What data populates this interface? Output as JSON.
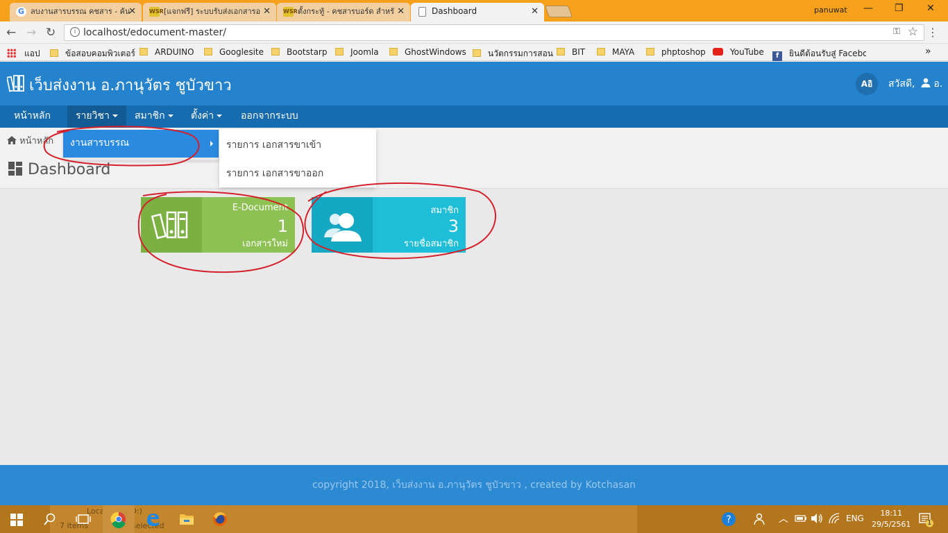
{
  "browser": {
    "tabs": [
      {
        "title": "ลบงานสารบรรณ คชสาร - ค้น",
        "favicon": "google-icon"
      },
      {
        "title": "[แจกฟรี] ระบบรับส่งเอกสารอ",
        "favicon": "wsr-icon"
      },
      {
        "title": "ตั้งกระทู้ - คชสารบอร์ด สำหรั",
        "favicon": "wsr-icon"
      },
      {
        "title": "Dashboard",
        "favicon": "document-icon",
        "active": true
      }
    ],
    "profile_name": "panuwat",
    "url": "localhost/edocument-master/",
    "bookmarks": [
      "แอป",
      "ข้อสอบคอมพิวเตอร์",
      "ARDUINO",
      "Googlesite",
      "Bootstarp",
      "Joomla",
      "GhostWindows",
      "นวัตกรรมการสอน",
      "BIT",
      "MAYA",
      "phptoshop",
      "YouTube",
      "ยินดีต้อนรับสู่ Faceboo"
    ],
    "overflow_symbol": "»"
  },
  "app": {
    "title": "เว็บส่งงาน อ.ภานุวัตร ชูบัวขาว",
    "language_button": "Aอิ",
    "greeting": "สวัสดี,",
    "nav": [
      "หน้าหลัก",
      "รายวิชา",
      "สมาชิก",
      "ตั้งค่า",
      "ออกจากระบบ"
    ],
    "dropdown": {
      "item": "งานสารบรรณ",
      "submenu": [
        "รายการ เอกสารขาเข้า",
        "รายการ เอกสารขาออก"
      ]
    },
    "breadcrumb": "หน้าหลัก",
    "page_title": "Dashboard",
    "cards": [
      {
        "label": "E-Document",
        "count": "1",
        "sub": "เอกสารใหม่",
        "color": "#8dc153",
        "icon_bg": "#7cb043",
        "icon": "binders-icon"
      },
      {
        "label": "สมาชิก",
        "count": "3",
        "sub": "รายชื่อสมาชิก",
        "color": "#1ebed9",
        "icon_bg": "#14a8c2",
        "icon": "users-icon"
      }
    ],
    "footer": "copyright 2018, เว็บส่งงาน อ.ภานุวัตร ชูบัวขาว , created by Kotchasan"
  },
  "taskbar": {
    "ghost_folder": "Local Disk (D:)",
    "ghost_items": "7 items",
    "ghost_selected": "selected",
    "language": "ENG",
    "time": "18:11",
    "date": "29/5/2561",
    "notification_count": "1"
  },
  "colors": {
    "tabstrip": "#f7a01c",
    "header": "#2582cc",
    "nav": "#176baf",
    "footer": "#2c8ad3",
    "taskbar": "#b3761d",
    "marker": "#d4202a"
  }
}
